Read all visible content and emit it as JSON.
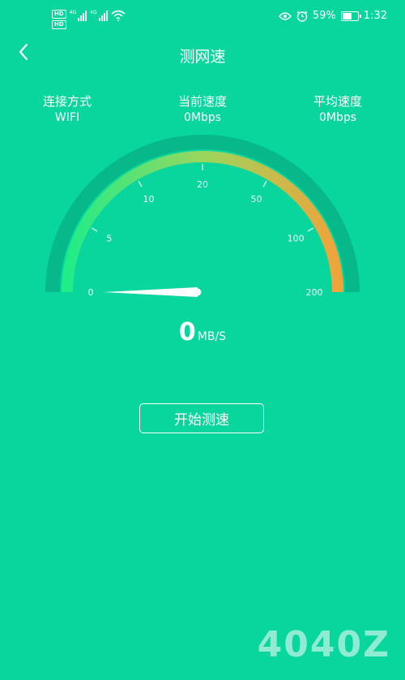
{
  "status_bar": {
    "hd_badges": [
      "HD",
      "HD"
    ],
    "signal_labels": [
      "4G",
      "4G"
    ],
    "battery": "59%",
    "time": "1:32",
    "icons": [
      "eye-icon",
      "alarm-icon",
      "battery-icon",
      "wifi-icon"
    ]
  },
  "header": {
    "title": "测网速",
    "back_icon": "chevron-left-icon"
  },
  "stats": [
    {
      "label": "连接方式",
      "value": "WIFI"
    },
    {
      "label": "当前速度",
      "value": "0Mbps"
    },
    {
      "label": "平均速度",
      "value": "0Mbps"
    }
  ],
  "gauge": {
    "ticks": [
      "0",
      "5",
      "10",
      "20",
      "50",
      "100",
      "200"
    ],
    "current_value": 0,
    "colors": {
      "start": "#1aee8a",
      "mid": "#9ad65e",
      "end": "#f4a13a",
      "track": "#06b88a"
    }
  },
  "speed": {
    "value": "0",
    "unit": "MB/S"
  },
  "button": {
    "label": "开始测速"
  },
  "watermark": "4040Z"
}
